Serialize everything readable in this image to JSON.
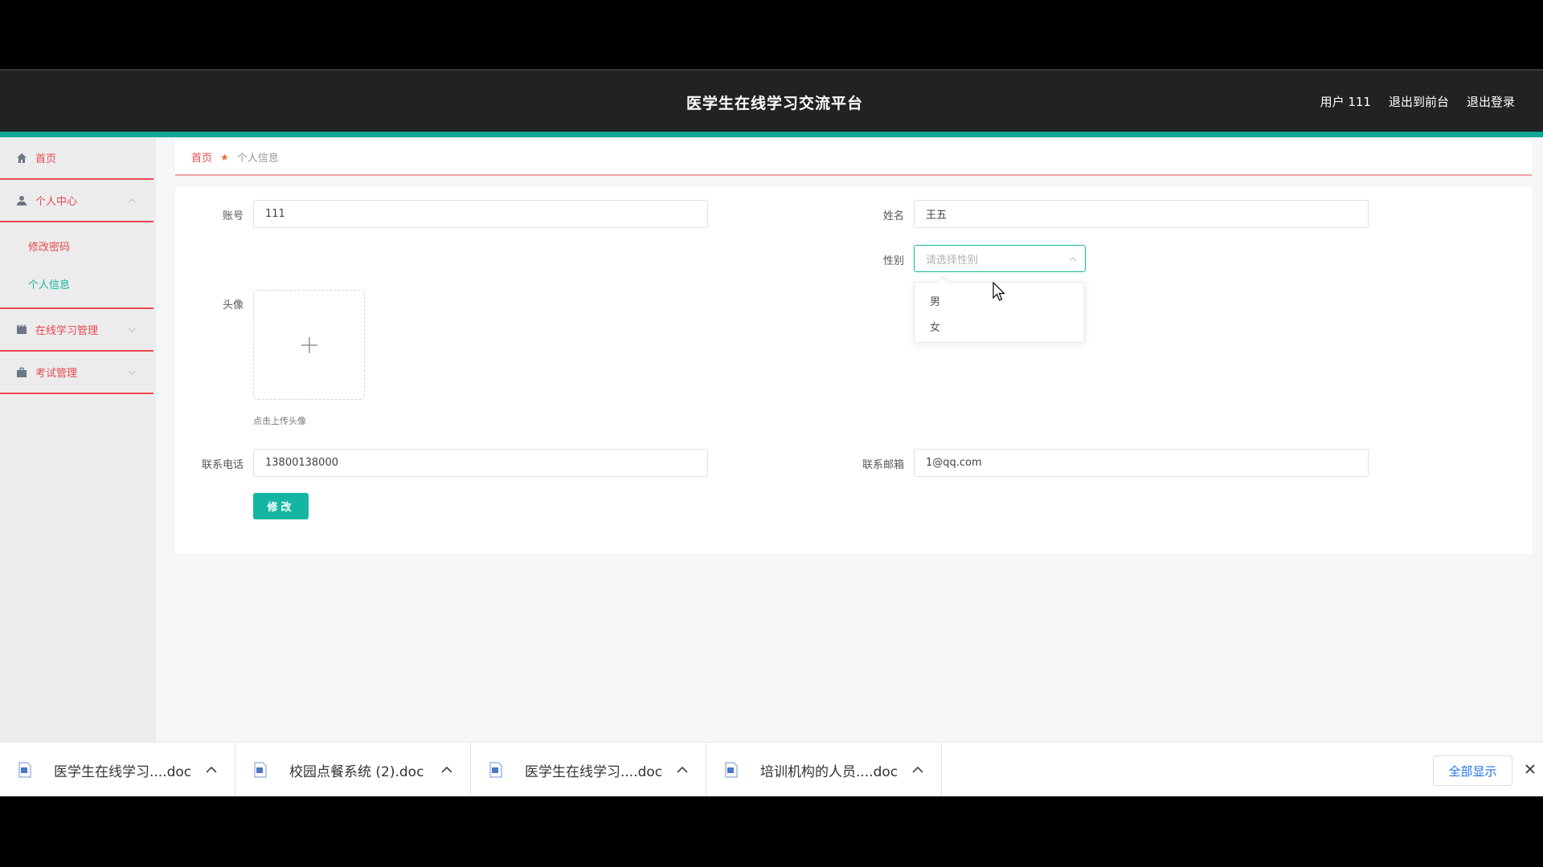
{
  "header": {
    "title": "医学生在线学习交流平台",
    "links": [
      "用户 111",
      "退出到前台",
      "退出登录"
    ]
  },
  "sidebar": {
    "home": "首页",
    "personal_center": "个人中心",
    "personal_sub": [
      "修改密码",
      "个人信息"
    ],
    "online_learning": "在线学习管理",
    "exam": "考试管理"
  },
  "breadcrumb": {
    "home": "首页",
    "current": "个人信息"
  },
  "form": {
    "account_label": "账号",
    "account_value": "111",
    "name_label": "姓名",
    "name_value": "王五",
    "gender_label": "性别",
    "gender_placeholder": "请选择性别",
    "gender_options": [
      "男",
      "女"
    ],
    "avatar_label": "头像",
    "avatar_hint": "点击上传头像",
    "phone_label": "联系电话",
    "phone_value": "13800138000",
    "email_label": "联系邮箱",
    "email_value": "1@qq.com",
    "submit_label": "修改"
  },
  "downloads": {
    "items": [
      "医学生在线学习....doc",
      "校园点餐系统 (2).doc",
      "医学生在线学习....doc",
      "培训机构的人员....doc"
    ],
    "show_all": "全部显示"
  },
  "colors": {
    "topbar": "#222222",
    "accent_teal": "#14b6a2",
    "accent_red": "#e8484e"
  }
}
